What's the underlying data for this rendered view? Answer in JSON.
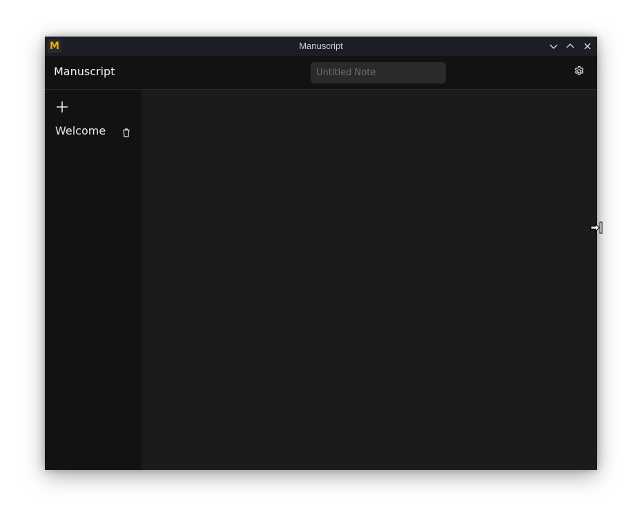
{
  "window": {
    "title": "Manuscript",
    "app_icon_letter": "M",
    "controls": {
      "minimize_icon": "chevron-down-icon",
      "maximize_icon": "chevron-up-icon",
      "close_icon": "close-icon"
    }
  },
  "header": {
    "brand": "Manuscript",
    "note_title": {
      "value": "",
      "placeholder": "Untitled Note"
    },
    "settings_icon": "gear-icon"
  },
  "sidebar": {
    "add_icon": "plus-icon",
    "notes": [
      {
        "label": "Welcome",
        "delete_icon": "trash-icon"
      }
    ]
  },
  "editor": {
    "content": ""
  },
  "colors": {
    "accent": "#f0a814",
    "titlebar": "#1c1e26",
    "header": "#121212",
    "sidebar": "#121212",
    "editor": "#1b1b1b",
    "input": "#2a2a2a"
  }
}
